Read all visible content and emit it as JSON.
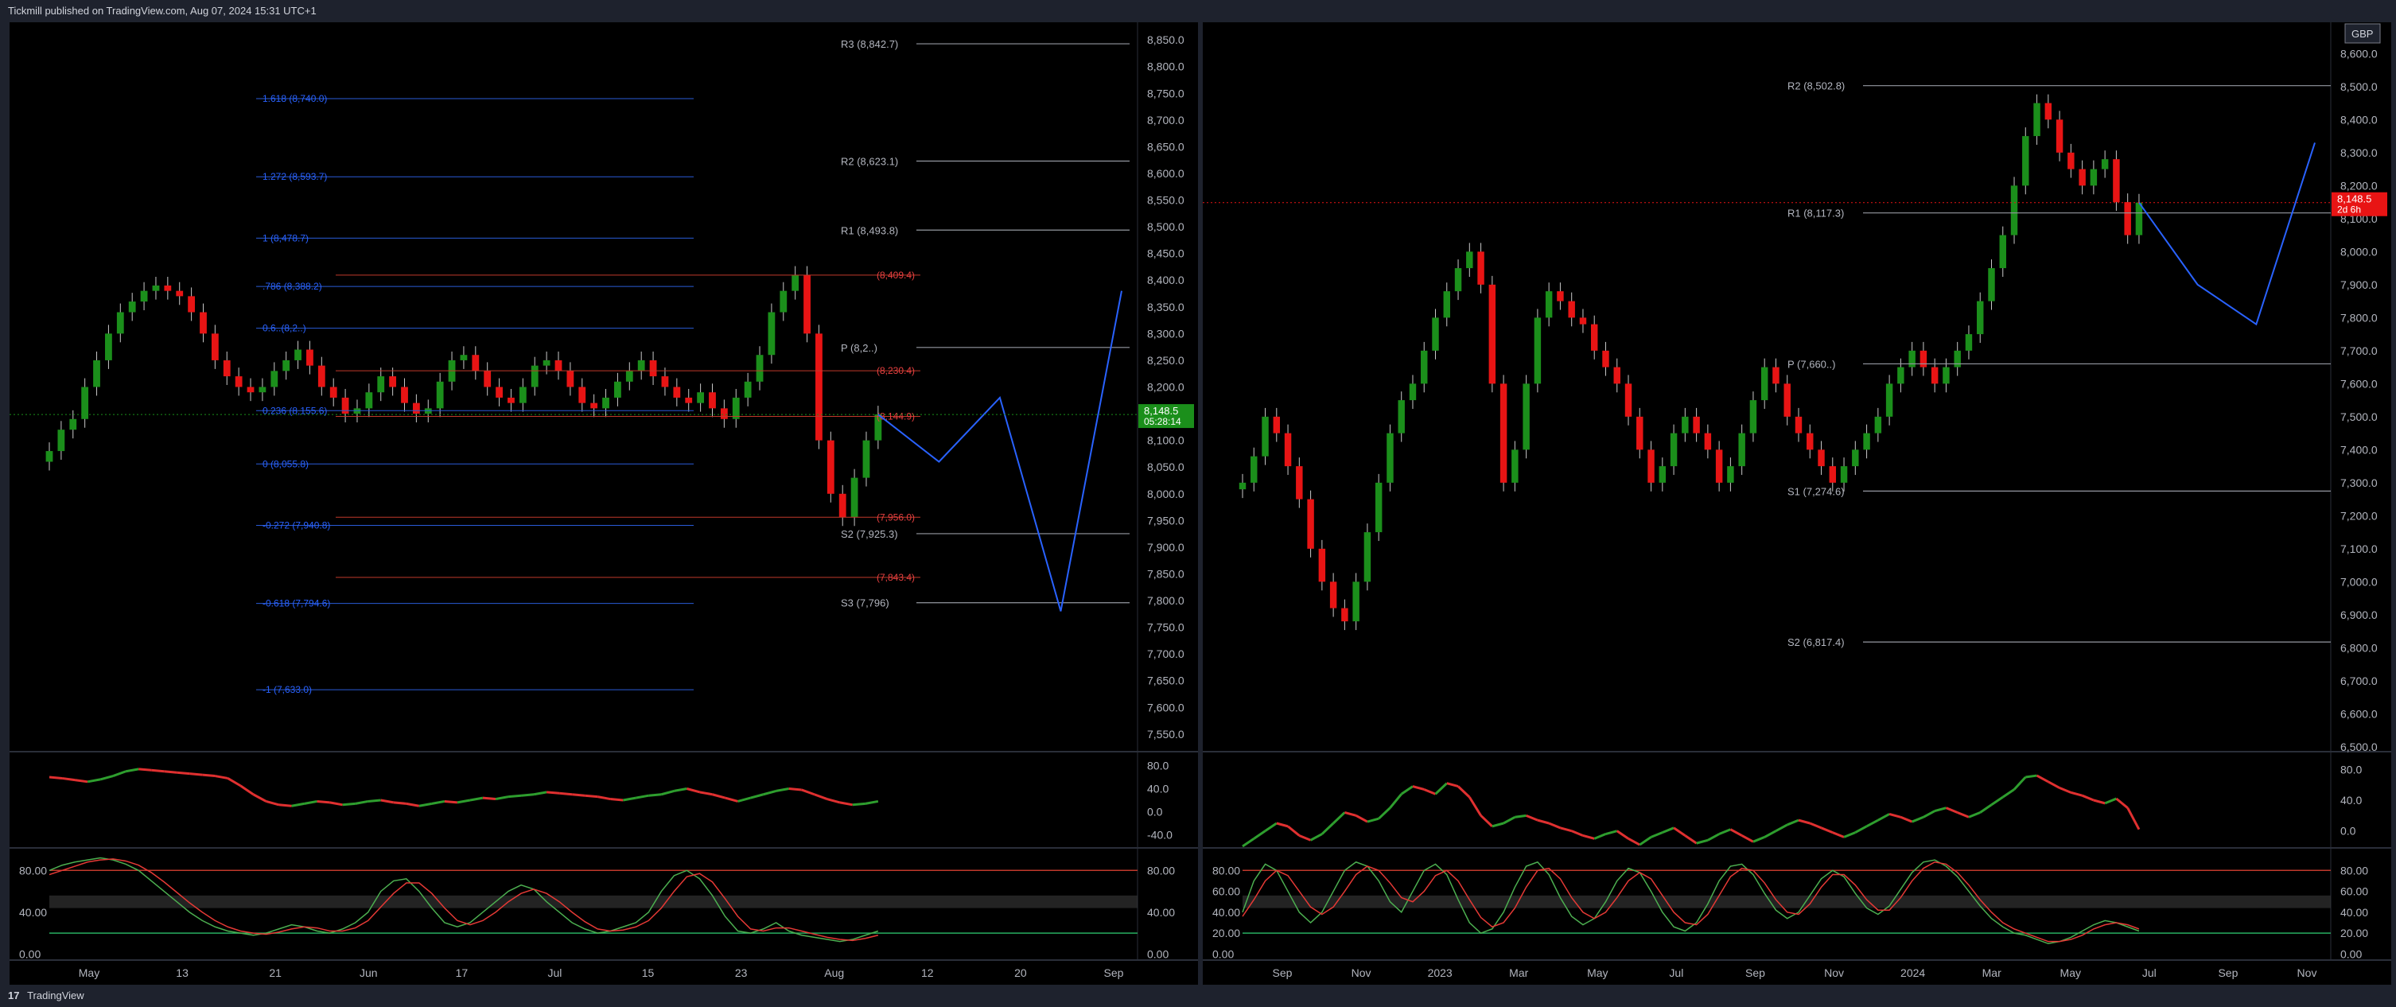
{
  "header": {
    "published_text": "Tickmill published on TradingView.com, Aug 07, 2024 15:31 UTC+1"
  },
  "footer": {
    "brand": "TradingView",
    "logo_glyph": "17"
  },
  "chart_data": [
    {
      "type": "line",
      "panel": "left",
      "series_note": "daily candlestick price chart",
      "price_axis": {
        "ticks": [
          8850,
          8800,
          8750,
          8700,
          8650,
          8600,
          8550,
          8500,
          8450,
          8400,
          8350,
          8300,
          8250,
          8200,
          8150,
          8100,
          8050,
          8000,
          7950,
          7900,
          7850,
          7800,
          7750,
          7700,
          7650,
          7600,
          7550
        ],
        "labels": [
          "8,850.0",
          "8,800.0",
          "8,750.0",
          "8,700.0",
          "8,650.0",
          "8,600.0",
          "8,550.0",
          "8,500.0",
          "8,450.0",
          "8,400.0",
          "8,350.0",
          "8,300.0",
          "8,250.0",
          "8,200.0",
          "8,150.0",
          "8,100.0",
          "8,050.0",
          "8,000.0",
          "7,950.0",
          "7,900.0",
          "7,850.0",
          "7,800.0",
          "7,750.0",
          "7,700.0",
          "7,650.0",
          "7,600.0",
          "7,550.0"
        ],
        "ylim": [
          7520,
          8880
        ]
      },
      "time_axis": {
        "labels": [
          "May",
          "13",
          "21",
          "Jun",
          "17",
          "Jul",
          "15",
          "23",
          "Aug",
          "12",
          "20",
          "Sep"
        ]
      },
      "last_price": "8,148.5",
      "countdown": "05:28:14",
      "pivot_levels": [
        {
          "label": "R3 (8,842.7)",
          "value": 8842.7
        },
        {
          "label": "R2 (8,623.1)",
          "value": 8623.1
        },
        {
          "label": "R1 (8,493.8)",
          "value": 8493.8
        },
        {
          "label": "P (8,2..)",
          "value": 8274
        },
        {
          "label": "S2 (7,925.3)",
          "value": 7925.3
        },
        {
          "label": "S3 (7,796)",
          "value": 7796
        }
      ],
      "fib_levels": [
        {
          "label": "1.618 (8,740.0)",
          "value": 8740.0
        },
        {
          "label": "1.272 (8,593.7)",
          "value": 8593.7
        },
        {
          "label": "1 (8,478.7)",
          "value": 8478.7
        },
        {
          "label": ".786 (8,388.2)",
          "value": 8388.2
        },
        {
          "label": "0.6..(8,2..)",
          "value": 8310
        },
        {
          "label": "0.236 (8,155.6)",
          "value": 8155.6
        },
        {
          "label": "0 (8,055.8)",
          "value": 8055.8
        },
        {
          "label": "-0.272 (7,940.8)",
          "value": 7940.8
        },
        {
          "label": "-0.618 (7,794.6)",
          "value": 7794.6
        },
        {
          "label": "-1 (7,633.0)",
          "value": 7633.0
        }
      ],
      "recent_levels": [
        {
          "label": "(8,409.4)",
          "value": 8409.4
        },
        {
          "label": "(8,230.4)",
          "value": 8230.4
        },
        {
          "label": "(8,144.9)",
          "value": 8144.9
        },
        {
          "label": "(7,956.0)",
          "value": 7956.0
        },
        {
          "label": "(7,843.4)",
          "value": 7843.4
        }
      ],
      "closes": [
        8080,
        8120,
        8140,
        8200,
        8250,
        8300,
        8340,
        8360,
        8380,
        8390,
        8380,
        8370,
        8340,
        8300,
        8250,
        8220,
        8200,
        8190,
        8200,
        8230,
        8250,
        8270,
        8240,
        8200,
        8180,
        8150,
        8160,
        8190,
        8220,
        8200,
        8170,
        8150,
        8160,
        8210,
        8250,
        8260,
        8230,
        8200,
        8180,
        8170,
        8200,
        8240,
        8250,
        8230,
        8200,
        8170,
        8160,
        8180,
        8210,
        8230,
        8250,
        8220,
        8200,
        8180,
        8170,
        8190,
        8160,
        8140,
        8180,
        8210,
        8260,
        8340,
        8380,
        8410,
        8300,
        8100,
        8000,
        7956,
        8030,
        8100,
        8148.5
      ],
      "projection_path": [
        [
          8148,
          8060
        ],
        [
          8230,
          8180
        ],
        [
          7780,
          7780
        ],
        [
          8380,
          8380
        ]
      ],
      "rsi": {
        "ticks": [
          "80.0",
          "40.0",
          "0.0",
          "-40.0"
        ],
        "tick_values": [
          80,
          40,
          0,
          -40
        ],
        "values": [
          60,
          58,
          55,
          52,
          56,
          62,
          70,
          74,
          72,
          70,
          68,
          66,
          64,
          62,
          58,
          45,
          30,
          18,
          12,
          10,
          14,
          18,
          16,
          12,
          14,
          18,
          20,
          16,
          14,
          10,
          14,
          18,
          16,
          20,
          24,
          22,
          26,
          28,
          30,
          34,
          32,
          30,
          28,
          26,
          22,
          20,
          24,
          28,
          30,
          36,
          40,
          34,
          30,
          24,
          18,
          24,
          30,
          36,
          40,
          38,
          30,
          22,
          16,
          12,
          14,
          18
        ]
      },
      "stoch": {
        "ticks": [
          "80.00",
          "40.00",
          "0.00"
        ],
        "tick_values": [
          80,
          40,
          0
        ],
        "k": [
          80,
          85,
          88,
          90,
          92,
          90,
          86,
          80,
          70,
          60,
          50,
          40,
          32,
          26,
          22,
          20,
          18,
          20,
          24,
          28,
          26,
          22,
          20,
          24,
          30,
          40,
          60,
          70,
          72,
          60,
          44,
          30,
          26,
          30,
          40,
          50,
          60,
          66,
          62,
          50,
          40,
          30,
          24,
          20,
          22,
          26,
          30,
          40,
          60,
          75,
          80,
          72,
          56,
          36,
          22,
          20,
          24,
          30,
          22,
          18,
          16,
          14,
          12,
          14,
          18,
          22
        ],
        "d": [
          76,
          80,
          84,
          88,
          90,
          91,
          89,
          85,
          78,
          69,
          59,
          49,
          40,
          32,
          26,
          22,
          20,
          19,
          21,
          24,
          26,
          25,
          22,
          22,
          25,
          32,
          45,
          58,
          68,
          68,
          58,
          44,
          32,
          28,
          32,
          40,
          50,
          58,
          62,
          58,
          50,
          40,
          31,
          24,
          22,
          23,
          26,
          32,
          44,
          60,
          74,
          77,
          69,
          53,
          36,
          24,
          22,
          25,
          25,
          22,
          19,
          16,
          14,
          13,
          15,
          18
        ]
      }
    },
    {
      "type": "line",
      "panel": "right",
      "series_note": "weekly candlestick price chart",
      "currency_badge": "GBP",
      "price_axis": {
        "ticks": [
          8600,
          8500,
          8400,
          8300,
          8200,
          8100,
          8000,
          7900,
          7800,
          7700,
          7600,
          7500,
          7400,
          7300,
          7200,
          7100,
          7000,
          6900,
          6800,
          6700,
          6600,
          6500
        ],
        "labels": [
          "8,600.0",
          "8,500.0",
          "8,400.0",
          "8,300.0",
          "8,200.0",
          "8,100.0",
          "8,000.0",
          "7,900.0",
          "7,800.0",
          "7,700.0",
          "7,600.0",
          "7,500.0",
          "7,400.0",
          "7,300.0",
          "7,200.0",
          "7,100.0",
          "7,000.0",
          "6,900.0",
          "6,800.0",
          "6,700.0",
          "6,600.0",
          "6,500.0"
        ],
        "ylim": [
          6490,
          8690
        ]
      },
      "time_axis": {
        "labels": [
          "Sep",
          "Nov",
          "2023",
          "Mar",
          "May",
          "Jul",
          "Sep",
          "Nov",
          "2024",
          "Mar",
          "May",
          "Jul",
          "Sep",
          "Nov"
        ]
      },
      "last_price": "8,148.5",
      "countdown": "2d 6h",
      "pivot_levels": [
        {
          "label": "R2 (8,502.8)",
          "value": 8502.8
        },
        {
          "label": "R1 (8,117.3)",
          "value": 8117.3
        },
        {
          "label": "P (7,660..)",
          "value": 7660
        },
        {
          "label": "S1 (7,274.6)",
          "value": 7274.6
        },
        {
          "label": "S2 (6,817.4)",
          "value": 6817.4
        }
      ],
      "closes": [
        7300,
        7380,
        7500,
        7450,
        7350,
        7250,
        7100,
        7000,
        6920,
        6880,
        7000,
        7150,
        7300,
        7450,
        7550,
        7600,
        7700,
        7800,
        7880,
        7950,
        8000,
        7900,
        7600,
        7300,
        7400,
        7600,
        7800,
        7880,
        7850,
        7800,
        7780,
        7700,
        7650,
        7600,
        7500,
        7400,
        7300,
        7350,
        7450,
        7500,
        7450,
        7400,
        7300,
        7350,
        7450,
        7550,
        7650,
        7600,
        7500,
        7450,
        7400,
        7350,
        7300,
        7350,
        7400,
        7450,
        7500,
        7600,
        7650,
        7700,
        7650,
        7600,
        7650,
        7700,
        7750,
        7850,
        7950,
        8050,
        8200,
        8350,
        8450,
        8400,
        8300,
        8250,
        8200,
        8250,
        8280,
        8150,
        8050,
        8148.5
      ],
      "projection_path": [
        [
          8148,
          7900
        ],
        [
          8250,
          7780
        ],
        [
          8330,
          8330
        ]
      ],
      "rsi": {
        "ticks": [
          "80.0",
          "40.0",
          "0.0"
        ],
        "tick_values": [
          80,
          40,
          0
        ],
        "values": [
          -20,
          -10,
          0,
          10,
          6,
          -6,
          -12,
          -4,
          10,
          24,
          20,
          12,
          16,
          30,
          48,
          58,
          54,
          48,
          62,
          58,
          44,
          20,
          6,
          10,
          18,
          20,
          14,
          10,
          4,
          0,
          -6,
          -10,
          -4,
          0,
          -10,
          -18,
          -8,
          -2,
          4,
          -6,
          -16,
          -12,
          -4,
          2,
          -6,
          -14,
          -8,
          0,
          8,
          14,
          10,
          4,
          -2,
          -8,
          -2,
          6,
          14,
          22,
          18,
          12,
          18,
          26,
          30,
          24,
          18,
          24,
          34,
          44,
          54,
          70,
          72,
          64,
          56,
          50,
          46,
          40,
          36,
          42,
          30,
          2
        ]
      },
      "stoch": {
        "ticks": [
          "80.00",
          "60.00",
          "40.00",
          "20.00",
          "0.00"
        ],
        "tick_values": [
          80,
          60,
          40,
          20,
          0
        ],
        "k": [
          40,
          70,
          86,
          80,
          60,
          40,
          30,
          40,
          60,
          80,
          88,
          84,
          70,
          50,
          40,
          60,
          80,
          86,
          76,
          52,
          30,
          20,
          24,
          40,
          64,
          84,
          88,
          76,
          54,
          36,
          28,
          34,
          50,
          70,
          82,
          78,
          60,
          40,
          26,
          22,
          30,
          48,
          70,
          84,
          86,
          76,
          58,
          42,
          34,
          40,
          56,
          72,
          80,
          74,
          58,
          44,
          38,
          46,
          62,
          78,
          88,
          90,
          84,
          74,
          60,
          46,
          34,
          26,
          20,
          18,
          14,
          10,
          12,
          16,
          22,
          28,
          32,
          30,
          26,
          22
        ],
        "d": [
          36,
          52,
          70,
          80,
          75,
          60,
          45,
          38,
          45,
          60,
          76,
          84,
          80,
          68,
          54,
          50,
          60,
          75,
          80,
          70,
          52,
          35,
          26,
          30,
          44,
          64,
          80,
          82,
          72,
          54,
          40,
          34,
          40,
          54,
          70,
          78,
          72,
          56,
          40,
          30,
          28,
          38,
          56,
          74,
          82,
          80,
          68,
          52,
          40,
          38,
          48,
          64,
          76,
          76,
          66,
          52,
          42,
          42,
          54,
          70,
          82,
          88,
          86,
          78,
          66,
          52,
          40,
          30,
          24,
          20,
          16,
          12,
          12,
          14,
          18,
          24,
          28,
          30,
          28,
          24
        ]
      }
    }
  ]
}
